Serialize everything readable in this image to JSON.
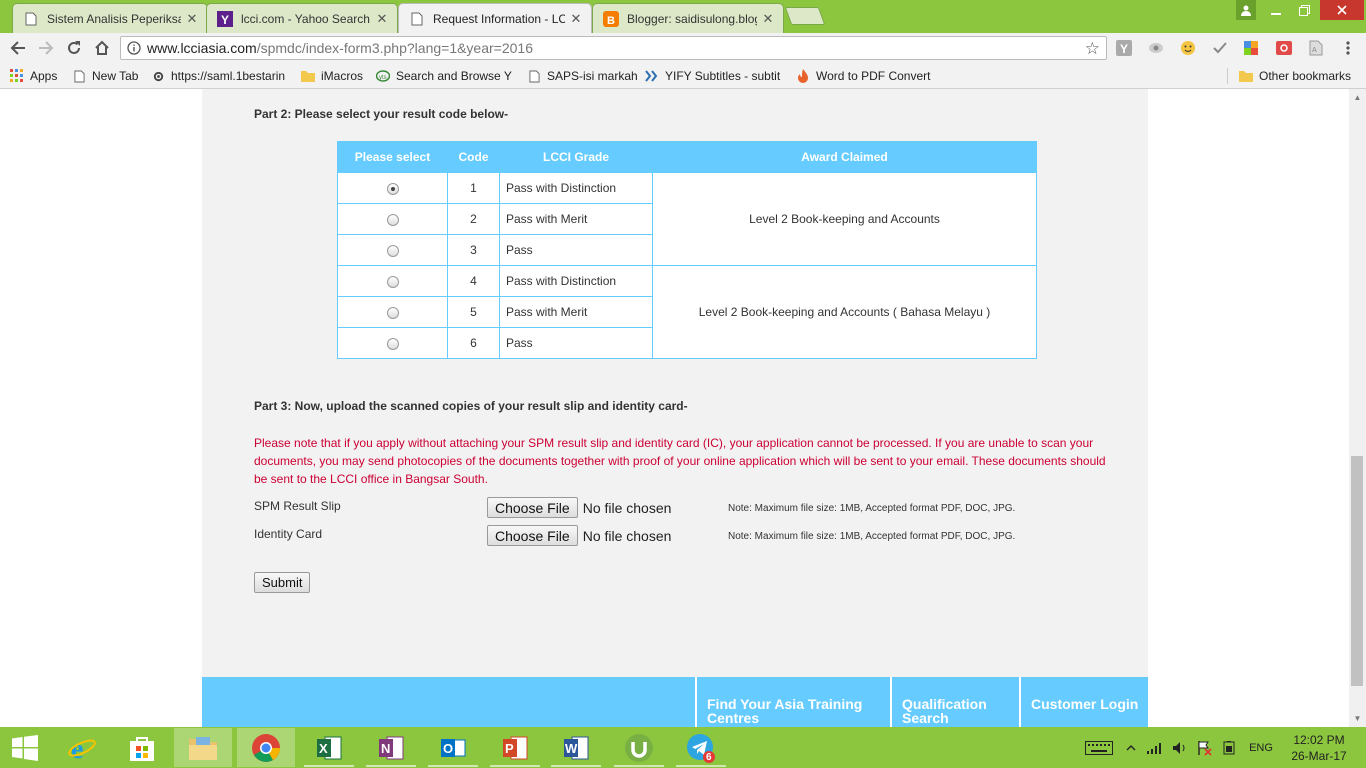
{
  "browser": {
    "tabs": [
      {
        "title": "Sistem Analisis Peperiksa",
        "icon": "page-icon",
        "active": false
      },
      {
        "title": "lcci.com - Yahoo Search R",
        "icon": "yahoo-icon",
        "active": false
      },
      {
        "title": "Request Information - LC",
        "icon": "page-icon",
        "active": true
      },
      {
        "title": "Blogger: saidisulong.blog",
        "icon": "blogger-icon",
        "active": false
      }
    ],
    "tab_close": "✕",
    "address": {
      "host": "www.lcciasia.com",
      "path": "/spmdc/index-form3.php?lang=1&year=2016"
    },
    "bookmarks": [
      {
        "label": "Apps",
        "icon": "apps-grid-icon"
      },
      {
        "label": "New Tab",
        "icon": "page-icon"
      },
      {
        "label": "https://saml.1bestarin",
        "icon": "gear-icon"
      },
      {
        "label": "iMacros",
        "icon": "folder-icon"
      },
      {
        "label": "Search and Browse YI",
        "icon": "yts-icon"
      },
      {
        "label": "SAPS-isi markah",
        "icon": "page-icon"
      },
      {
        "label": "YIFY Subtitles - subtit",
        "icon": "yify-icon"
      },
      {
        "label": "Word to PDF Convert",
        "icon": "flame-icon"
      }
    ],
    "other_bookmarks": "Other bookmarks"
  },
  "form": {
    "part2_title": "Part 2: Please select your result code below-",
    "table": {
      "headers": [
        "Please select",
        "Code",
        "LCCI Grade",
        "Award Claimed"
      ],
      "rows": [
        {
          "code": "1",
          "grade": "Pass with Distinction",
          "selected": true
        },
        {
          "code": "2",
          "grade": "Pass with Merit",
          "selected": false
        },
        {
          "code": "3",
          "grade": "Pass",
          "selected": false
        },
        {
          "code": "4",
          "grade": "Pass with Distinction",
          "selected": false
        },
        {
          "code": "5",
          "grade": "Pass with Merit",
          "selected": false
        },
        {
          "code": "6",
          "grade": "Pass",
          "selected": false
        }
      ],
      "awards": [
        "Level 2 Book-keeping and Accounts",
        "Level 2 Book-keeping and Accounts ( Bahasa Melayu )"
      ]
    },
    "part3_title": "Part 3: Now, upload the scanned copies of your result slip and identity card-",
    "note": "Please note that if you apply without attaching your SPM result slip and identity card (IC), your application cannot be processed. If you are unable to scan your documents, you may send photocopies of the documents together with proof of your online application which will be sent to your email. These documents should be sent to the LCCI office in Bangsar South.",
    "uploads": [
      {
        "label": "SPM Result Slip",
        "button": "Choose File",
        "status": "No file chosen",
        "limit": "Note: Maximum file size: 1MB, Accepted format PDF, DOC, JPG."
      },
      {
        "label": "Identity Card",
        "button": "Choose File",
        "status": "No file chosen",
        "limit": "Note: Maximum file size: 1MB, Accepted format PDF, DOC, JPG."
      }
    ],
    "submit": "Submit"
  },
  "footer": {
    "links": [
      "Find Your Asia Training Centres",
      "Qualification Search",
      "Customer Login"
    ]
  },
  "taskbar": {
    "apps": [
      "start",
      "internet-explorer",
      "store",
      "file-explorer",
      "chrome",
      "excel",
      "onenote",
      "outlook",
      "powerpoint",
      "word",
      "utorrent",
      "telegram"
    ],
    "telegram_badge": "6",
    "language": "ENG",
    "time": "12:02 PM",
    "date": "26-Mar-17"
  },
  "colors": {
    "accent_green": "#8cc63f",
    "table_blue": "#66ccff",
    "note_red": "#cc0033"
  }
}
